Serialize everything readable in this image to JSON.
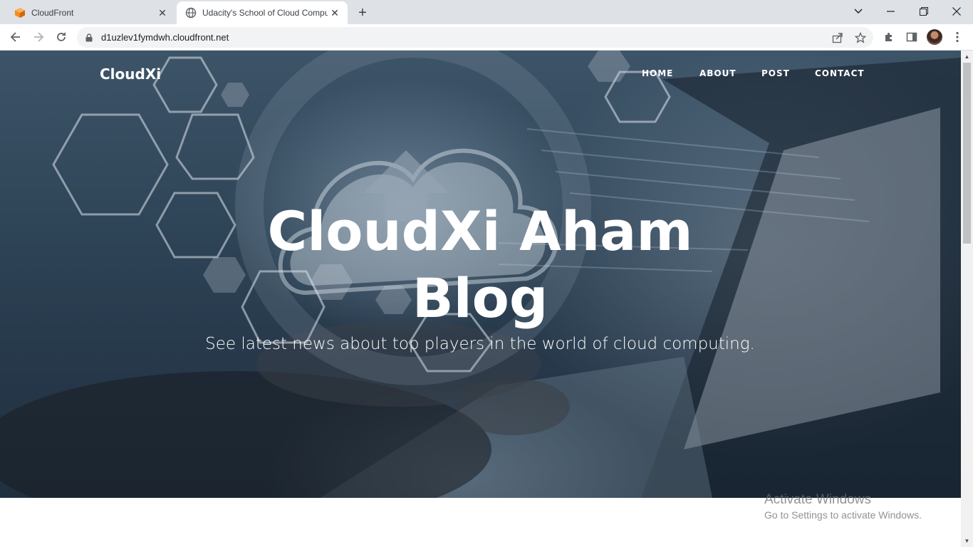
{
  "browser": {
    "tabs": [
      {
        "title": "CloudFront",
        "favicon": "aws-cube-icon",
        "active": false
      },
      {
        "title": "Udacity's School of Cloud Compu",
        "favicon": "globe-icon",
        "active": true
      }
    ],
    "address": "d1uzlev1fymdwh.cloudfront.net",
    "window_controls": {
      "dropdown": "⌄",
      "minimize": "—",
      "restore": "❐",
      "close": "✕"
    }
  },
  "site": {
    "brand": "CloudXi",
    "nav": [
      "HOME",
      "ABOUT",
      "POST",
      "CONTACT"
    ],
    "hero_title_line1": "CloudXi Aham",
    "hero_title_line2": "Blog",
    "hero_subtitle": "See latest news about top players in the world of cloud computing."
  },
  "os_watermark": {
    "title": "Activate Windows",
    "subtitle": "Go to Settings to activate Windows."
  },
  "colors": {
    "tabstrip": "#dee1e6",
    "omnibox": "#f1f3f4",
    "hero_overlay": "#2e4457",
    "aws_orange": "#f38b1f"
  }
}
